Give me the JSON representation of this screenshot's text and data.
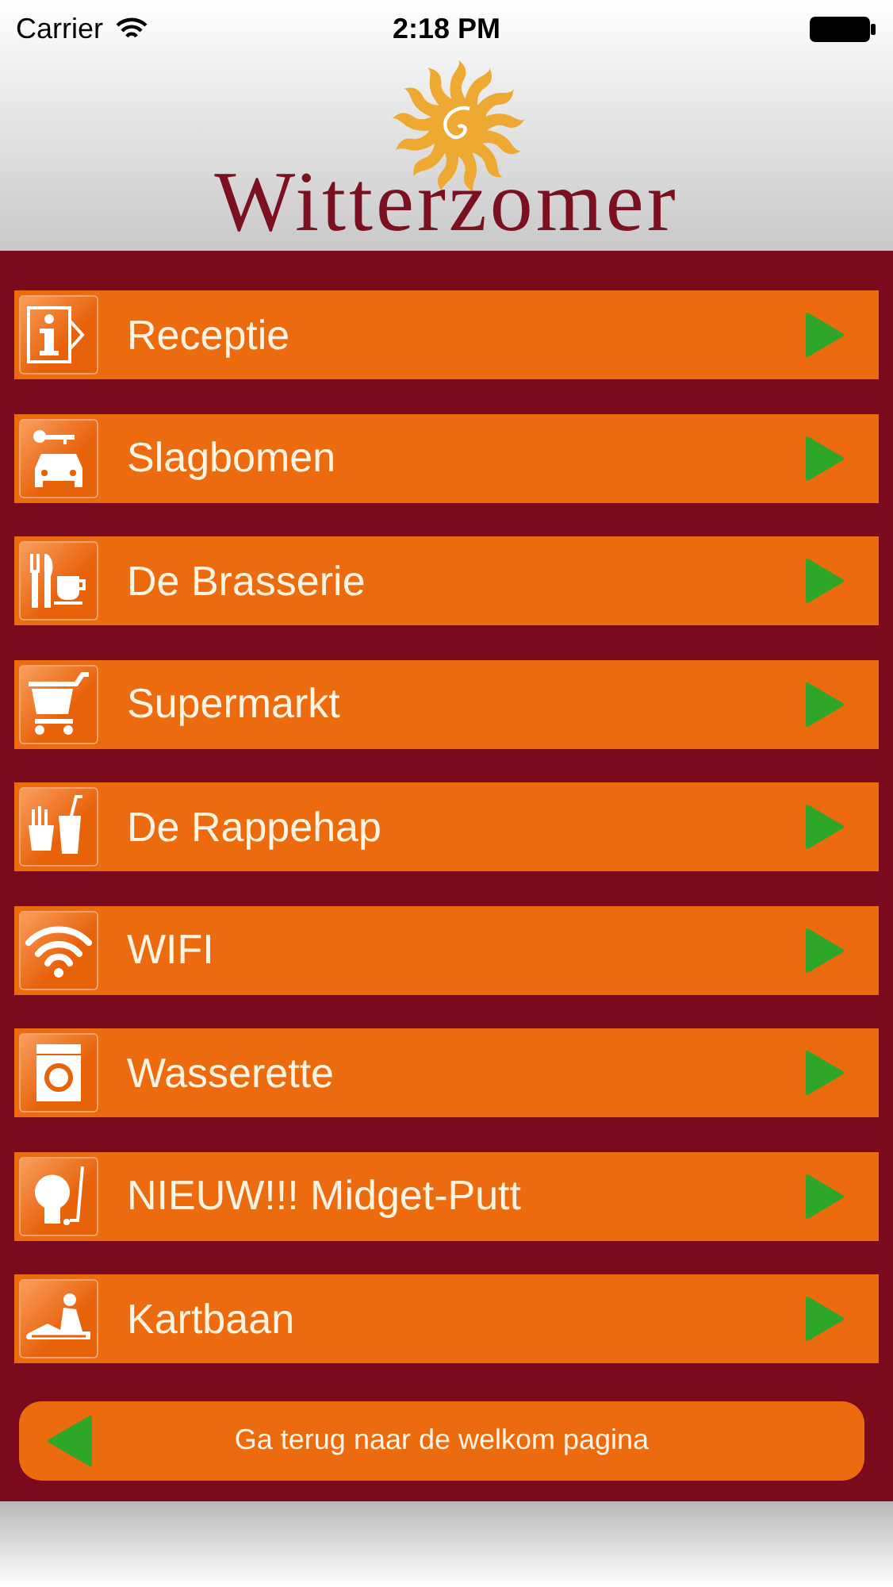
{
  "status_bar": {
    "carrier": "Carrier",
    "time": "2:18 PM"
  },
  "header": {
    "logo_text": "Witterzomer"
  },
  "menu": [
    {
      "label": "Receptie"
    },
    {
      "label": "Slagbomen"
    },
    {
      "label": "De Brasserie"
    },
    {
      "label": "Supermarkt"
    },
    {
      "label": "De Rappehap"
    },
    {
      "label": "WIFI"
    },
    {
      "label": "Wasserette"
    },
    {
      "label": "NIEUW!!! Midget-Putt"
    },
    {
      "label": "Kartbaan"
    }
  ],
  "back_button": {
    "label": "Ga terug naar de welkom pagina"
  }
}
